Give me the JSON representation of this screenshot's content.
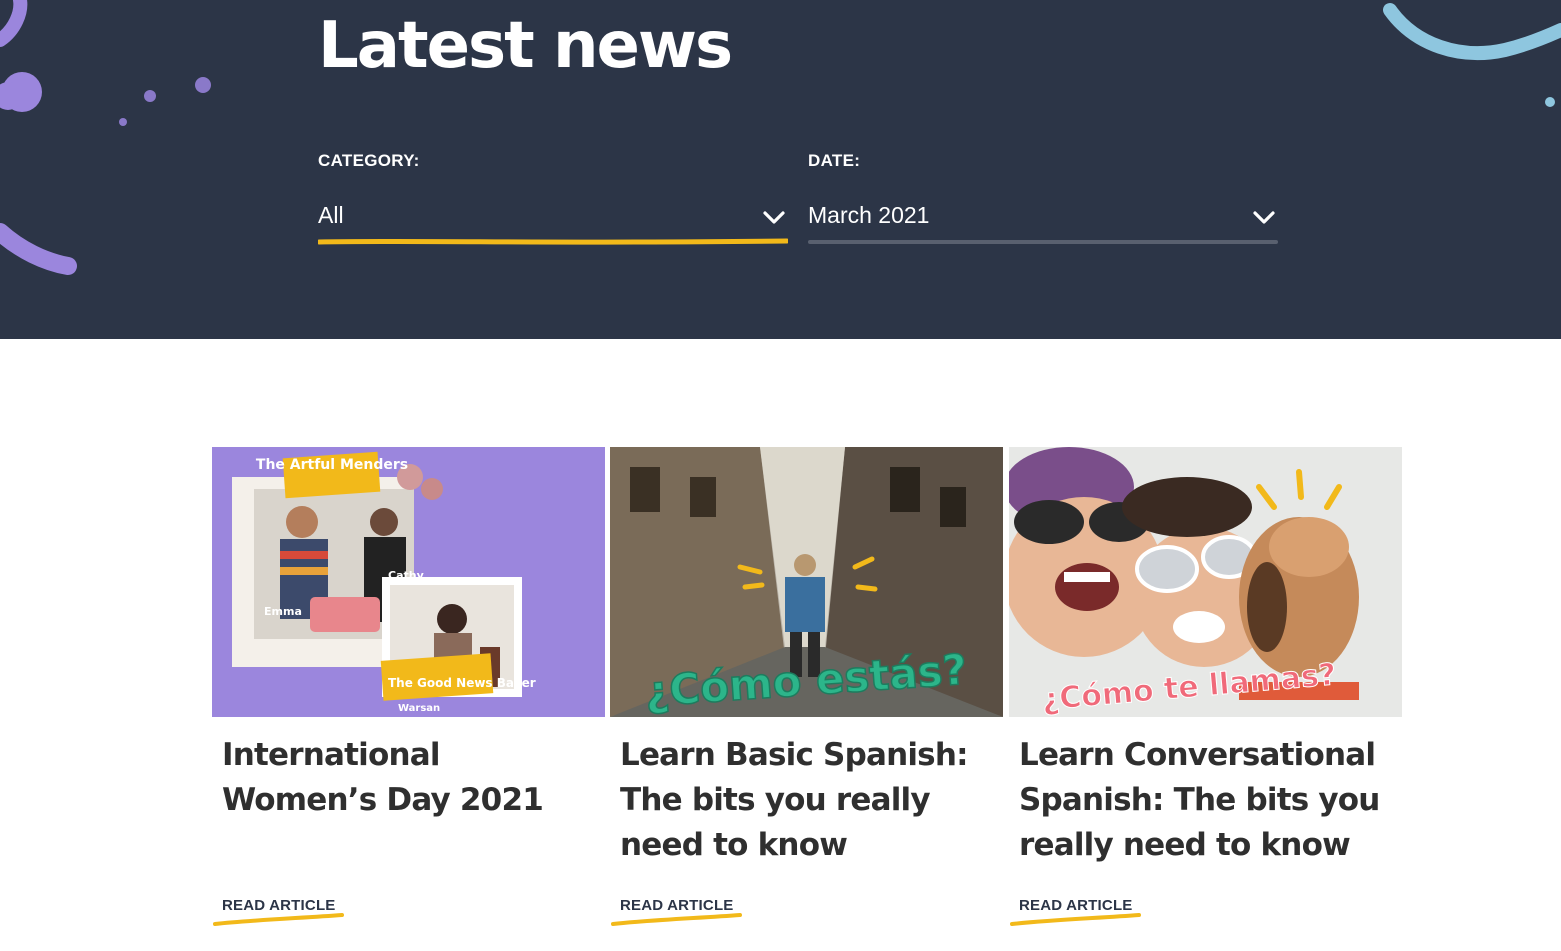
{
  "page": {
    "title": "Latest news"
  },
  "colors": {
    "hero_bg": "#2c3547",
    "accent_yellow": "#f2b91a",
    "purple": "#9b86dd",
    "teal": "#2cb58a",
    "heading_text": "#2f2f2f"
  },
  "filters": {
    "category": {
      "label": "CATEGORY:",
      "value": "All",
      "icon": "chevron-down-icon"
    },
    "date": {
      "label": "DATE:",
      "value": "March 2021",
      "icon": "chevron-down-icon"
    }
  },
  "articles": [
    {
      "title": "International Women’s Day 2021",
      "read_label": "READ ARTICLE",
      "image_texts": {
        "badge_top": "The Artful Menders",
        "name_left": "Emma",
        "name_right": "Cathy",
        "badge_bottom": "The Good News Baker",
        "name_bottom": "Warsan"
      }
    },
    {
      "title": "Learn Basic Spanish: The bits you really need to know",
      "read_label": "READ ARTICLE",
      "image_texts": {
        "overlay": "¿Cómo estás?"
      }
    },
    {
      "title": "Learn Conversational Spanish: The bits you really need to know",
      "read_label": "READ ARTICLE",
      "image_texts": {
        "overlay": "¿Cómo te llamas?"
      }
    }
  ]
}
